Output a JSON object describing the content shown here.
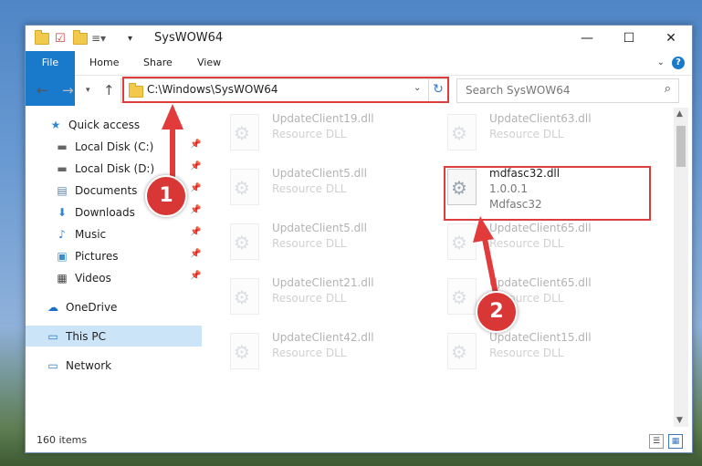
{
  "window": {
    "title": "SysWOW64",
    "minimize_glyph": "—",
    "maximize_glyph": "☐",
    "close_glyph": "✕"
  },
  "ribbon": {
    "tabs": [
      "File",
      "Home",
      "Share",
      "View"
    ],
    "help": "?"
  },
  "navigation": {
    "address": "C:\\Windows\\SysWOW64",
    "search_placeholder": "Search SysWOW64"
  },
  "sidebar": {
    "items": [
      {
        "label": "Quick access",
        "icon": "star-icon"
      },
      {
        "label": "Local Disk (C:)",
        "icon": "drive-icon",
        "pinned": true
      },
      {
        "label": "Local Disk (D:)",
        "icon": "drive-icon",
        "pinned": true
      },
      {
        "label": "Documents",
        "icon": "documents-icon",
        "pinned": true
      },
      {
        "label": "Downloads",
        "icon": "download-icon",
        "pinned": true
      },
      {
        "label": "Music",
        "icon": "music-icon",
        "pinned": true
      },
      {
        "label": "Pictures",
        "icon": "pictures-icon",
        "pinned": true
      },
      {
        "label": "Videos",
        "icon": "videos-icon",
        "pinned": true
      },
      {
        "label": "OneDrive",
        "icon": "cloud-icon"
      },
      {
        "label": "This PC",
        "icon": "computer-icon",
        "selected": true
      },
      {
        "label": "Network",
        "icon": "network-icon"
      }
    ]
  },
  "files": [
    {
      "name": "UpdateClient19.dll",
      "line2": "Resource DLL"
    },
    {
      "name": "UpdateClient63.dll",
      "line2": "Resource DLL"
    },
    {
      "name": "UpdateClient5.dll",
      "line2": "Resource DLL"
    },
    {
      "name": "mdfasc32.dll",
      "line2": "1.0.0.1",
      "line3": "Mdfasc32",
      "highlighted": true
    },
    {
      "name": "UpdateClient5.dll",
      "line2": "Resource DLL"
    },
    {
      "name": "UpdateClient65.dll",
      "line2": "Resource DLL"
    },
    {
      "name": "UpdateClient21.dll",
      "line2": "Resource DLL"
    },
    {
      "name": "UpdateClient65.dll",
      "line2": "Resource DLL"
    },
    {
      "name": "UpdateClient42.dll",
      "line2": "Resource DLL"
    },
    {
      "name": "UpdateClient15.dll",
      "line2": "Resource DLL"
    }
  ],
  "status": {
    "item_count": "160 items"
  },
  "annotations": {
    "step1": "1",
    "step2": "2"
  },
  "colors": {
    "accent": "#1979ca",
    "annotation_red": "#dc3d3d"
  }
}
